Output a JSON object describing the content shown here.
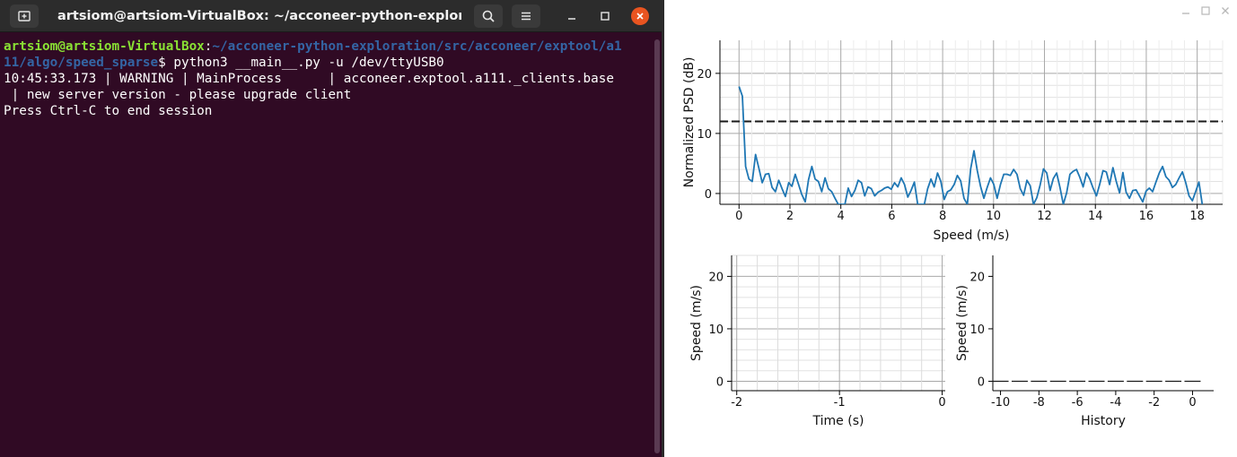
{
  "terminal": {
    "title": "artsiom@artsiom-VirtualBox: ~/acconeer-python-exploratio...",
    "prompt_user": "artsiom@artsiom-VirtualBox",
    "prompt_sep": ":",
    "prompt_path_1": "~/acconeer-python-exploration/src/acconeer/exptool/a1",
    "prompt_path_2": "11/algo/speed_sparse",
    "prompt_symbol": "$ ",
    "command": "python3 __main__.py -u /dev/ttyUSB0",
    "log_line_1": "10:45:33.173 | WARNING | MainProcess      | acconeer.exptool.a111._clients.base",
    "log_line_2": " | new server version - please upgrade client",
    "log_line_3": "Press Ctrl-C to end session",
    "icons": [
      "new-tab-icon",
      "search-icon",
      "hamburger-menu-icon",
      "minimize-icon",
      "maximize-icon",
      "close-icon"
    ]
  },
  "plot_window": {
    "icons": [
      "minimize-icon",
      "maximize-icon",
      "close-icon"
    ]
  },
  "chart_data": [
    {
      "type": "line",
      "title": "",
      "xlabel": "Speed (m/s)",
      "ylabel": "Normalized PSD (dB)",
      "xlim": [
        -0.75,
        19.0
      ],
      "ylim": [
        -1.8,
        25.5
      ],
      "xticks": [
        0,
        2,
        4,
        6,
        8,
        10,
        12,
        14,
        16,
        18
      ],
      "yticks": [
        0,
        10,
        20
      ],
      "grid": true,
      "threshold": 12,
      "colors": {
        "line": "#1f77b4",
        "threshold": "#1a1a1a"
      },
      "x": [
        0,
        0.13,
        0.26,
        0.39,
        0.52,
        0.65,
        0.78,
        0.91,
        1.04,
        1.17,
        1.3,
        1.43,
        1.56,
        1.69,
        1.82,
        1.95,
        2.08,
        2.21,
        2.34,
        2.47,
        2.6,
        2.73,
        2.86,
        2.99,
        3.12,
        3.25,
        3.38,
        3.51,
        3.64,
        3.77,
        3.9,
        4.03,
        4.16,
        4.29,
        4.42,
        4.55,
        4.68,
        4.81,
        4.94,
        5.07,
        5.2,
        5.33,
        5.46,
        5.59,
        5.72,
        5.85,
        5.98,
        6.11,
        6.24,
        6.37,
        6.5,
        6.63,
        6.76,
        6.89,
        7.02,
        7.15,
        7.28,
        7.41,
        7.54,
        7.67,
        7.8,
        7.93,
        8.06,
        8.19,
        8.32,
        8.45,
        8.58,
        8.71,
        8.84,
        8.97,
        9.1,
        9.23,
        9.36,
        9.49,
        9.62,
        9.75,
        9.88,
        10.01,
        10.14,
        10.27,
        10.4,
        10.53,
        10.66,
        10.79,
        10.92,
        11.05,
        11.18,
        11.31,
        11.44,
        11.57,
        11.7,
        11.83,
        11.96,
        12.09,
        12.22,
        12.35,
        12.48,
        12.61,
        12.74,
        12.87,
        13.0,
        13.13,
        13.26,
        13.39,
        13.52,
        13.65,
        13.78,
        13.91,
        14.04,
        14.17,
        14.3,
        14.43,
        14.56,
        14.69,
        14.82,
        14.95,
        15.08,
        15.21,
        15.34,
        15.47,
        15.6,
        15.73,
        15.86,
        15.99,
        16.12,
        16.25,
        16.38,
        16.51,
        16.64,
        16.77,
        16.9,
        17.03,
        17.16,
        17.29,
        17.42,
        17.55,
        17.68,
        17.81,
        17.94,
        18.07,
        18.2
      ],
      "y": [
        17.8,
        16.2,
        4.5,
        2.4,
        2.0,
        6.5,
        4.2,
        1.8,
        3.2,
        3.3,
        1.0,
        0.3,
        2.2,
        0.8,
        -0.5,
        1.8,
        1.2,
        3.2,
        1.5,
        -0.2,
        -1.4,
        2.3,
        4.5,
        2.4,
        2.0,
        0.3,
        2.6,
        0.8,
        0.3,
        -0.8,
        -1.8,
        -1.8,
        -1.8,
        0.9,
        -0.5,
        0.5,
        2.2,
        1.8,
        -0.4,
        1.1,
        0.8,
        -0.4,
        0.2,
        0.5,
        0.9,
        1.1,
        0.7,
        1.8,
        1.1,
        2.6,
        1.5,
        -0.6,
        0.5,
        1.9,
        -1.8,
        -1.8,
        -1.8,
        0.8,
        2.4,
        1.1,
        3.4,
        2.0,
        -1.0,
        0.3,
        0.6,
        1.5,
        3.0,
        2.1,
        -0.8,
        -1.8,
        4.1,
        7.1,
        3.8,
        1.2,
        -0.8,
        1.0,
        2.6,
        1.5,
        -0.8,
        1.5,
        3.2,
        3.2,
        3.0,
        4.0,
        3.2,
        0.8,
        -0.3,
        2.2,
        1.3,
        -1.8,
        -0.7,
        1.4,
        4.1,
        3.4,
        0.5,
        2.5,
        3.4,
        1.0,
        -1.8,
        0.1,
        3.2,
        3.7,
        4.0,
        2.7,
        1.1,
        3.4,
        2.4,
        0.9,
        -0.4,
        1.5,
        3.8,
        3.6,
        1.5,
        4.3,
        2.0,
        0.1,
        3.5,
        0.2,
        -0.8,
        0.5,
        0.6,
        -0.4,
        -1.4,
        0.4,
        0.9,
        0.3,
        1.9,
        3.4,
        4.5,
        2.8,
        2.2,
        1.0,
        1.5,
        2.6,
        3.6,
        1.8,
        -0.4,
        -1.2,
        0.3,
        1.9,
        -1.8
      ]
    },
    {
      "type": "line",
      "title": "",
      "xlabel": "Time (s)",
      "ylabel": "Speed (m/s)",
      "xlim": [
        -2.05,
        0.03
      ],
      "ylim": [
        -1.8,
        24.0
      ],
      "xticks": [
        -2,
        -1,
        0
      ],
      "yticks": [
        0,
        10,
        20
      ],
      "grid": true,
      "series": []
    },
    {
      "type": "line",
      "title": "",
      "xlabel": "History",
      "ylabel": "Speed (m/s)",
      "xlim": [
        -10.4,
        1.1
      ],
      "ylim": [
        -1.8,
        24.0
      ],
      "xticks": [
        -10,
        -8,
        -6,
        -4,
        -2,
        0
      ],
      "yticks": [
        0,
        10,
        20
      ],
      "grid": false,
      "dash_color": "#1a1a1a",
      "x": [
        -10,
        -9,
        -8,
        -7,
        -6,
        -5,
        -4,
        -3,
        -2,
        -1,
        0
      ],
      "y": [
        0,
        0,
        0,
        0,
        0,
        0,
        0,
        0,
        0,
        0,
        0
      ]
    }
  ]
}
